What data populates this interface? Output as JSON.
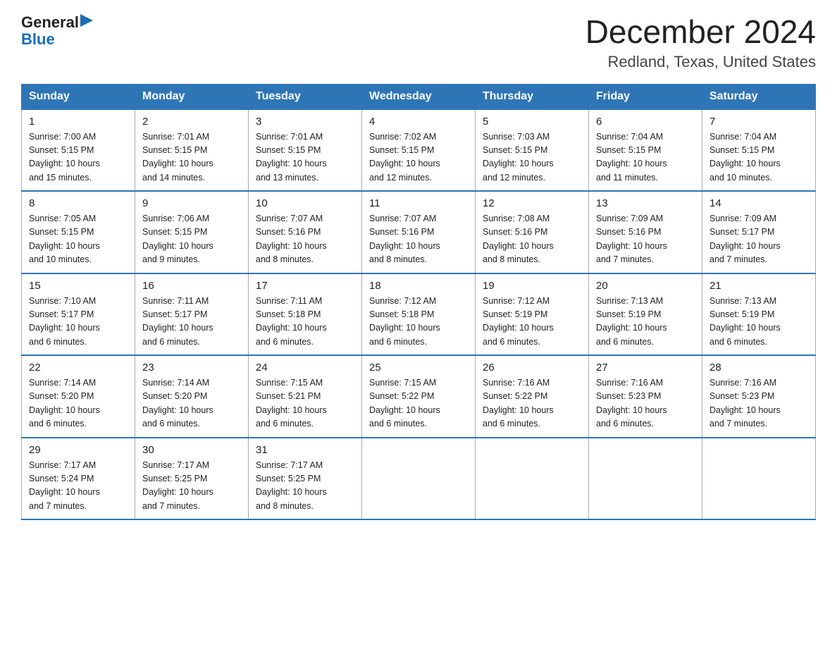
{
  "logo": {
    "general": "General",
    "blue": "Blue",
    "arrow": "▶"
  },
  "title": "December 2024",
  "subtitle": "Redland, Texas, United States",
  "days_of_week": [
    "Sunday",
    "Monday",
    "Tuesday",
    "Wednesday",
    "Thursday",
    "Friday",
    "Saturday"
  ],
  "weeks": [
    [
      {
        "day": "1",
        "sunrise": "7:00 AM",
        "sunset": "5:15 PM",
        "daylight": "10 hours and 15 minutes."
      },
      {
        "day": "2",
        "sunrise": "7:01 AM",
        "sunset": "5:15 PM",
        "daylight": "10 hours and 14 minutes."
      },
      {
        "day": "3",
        "sunrise": "7:01 AM",
        "sunset": "5:15 PM",
        "daylight": "10 hours and 13 minutes."
      },
      {
        "day": "4",
        "sunrise": "7:02 AM",
        "sunset": "5:15 PM",
        "daylight": "10 hours and 12 minutes."
      },
      {
        "day": "5",
        "sunrise": "7:03 AM",
        "sunset": "5:15 PM",
        "daylight": "10 hours and 12 minutes."
      },
      {
        "day": "6",
        "sunrise": "7:04 AM",
        "sunset": "5:15 PM",
        "daylight": "10 hours and 11 minutes."
      },
      {
        "day": "7",
        "sunrise": "7:04 AM",
        "sunset": "5:15 PM",
        "daylight": "10 hours and 10 minutes."
      }
    ],
    [
      {
        "day": "8",
        "sunrise": "7:05 AM",
        "sunset": "5:15 PM",
        "daylight": "10 hours and 10 minutes."
      },
      {
        "day": "9",
        "sunrise": "7:06 AM",
        "sunset": "5:15 PM",
        "daylight": "10 hours and 9 minutes."
      },
      {
        "day": "10",
        "sunrise": "7:07 AM",
        "sunset": "5:16 PM",
        "daylight": "10 hours and 8 minutes."
      },
      {
        "day": "11",
        "sunrise": "7:07 AM",
        "sunset": "5:16 PM",
        "daylight": "10 hours and 8 minutes."
      },
      {
        "day": "12",
        "sunrise": "7:08 AM",
        "sunset": "5:16 PM",
        "daylight": "10 hours and 8 minutes."
      },
      {
        "day": "13",
        "sunrise": "7:09 AM",
        "sunset": "5:16 PM",
        "daylight": "10 hours and 7 minutes."
      },
      {
        "day": "14",
        "sunrise": "7:09 AM",
        "sunset": "5:17 PM",
        "daylight": "10 hours and 7 minutes."
      }
    ],
    [
      {
        "day": "15",
        "sunrise": "7:10 AM",
        "sunset": "5:17 PM",
        "daylight": "10 hours and 6 minutes."
      },
      {
        "day": "16",
        "sunrise": "7:11 AM",
        "sunset": "5:17 PM",
        "daylight": "10 hours and 6 minutes."
      },
      {
        "day": "17",
        "sunrise": "7:11 AM",
        "sunset": "5:18 PM",
        "daylight": "10 hours and 6 minutes."
      },
      {
        "day": "18",
        "sunrise": "7:12 AM",
        "sunset": "5:18 PM",
        "daylight": "10 hours and 6 minutes."
      },
      {
        "day": "19",
        "sunrise": "7:12 AM",
        "sunset": "5:19 PM",
        "daylight": "10 hours and 6 minutes."
      },
      {
        "day": "20",
        "sunrise": "7:13 AM",
        "sunset": "5:19 PM",
        "daylight": "10 hours and 6 minutes."
      },
      {
        "day": "21",
        "sunrise": "7:13 AM",
        "sunset": "5:19 PM",
        "daylight": "10 hours and 6 minutes."
      }
    ],
    [
      {
        "day": "22",
        "sunrise": "7:14 AM",
        "sunset": "5:20 PM",
        "daylight": "10 hours and 6 minutes."
      },
      {
        "day": "23",
        "sunrise": "7:14 AM",
        "sunset": "5:20 PM",
        "daylight": "10 hours and 6 minutes."
      },
      {
        "day": "24",
        "sunrise": "7:15 AM",
        "sunset": "5:21 PM",
        "daylight": "10 hours and 6 minutes."
      },
      {
        "day": "25",
        "sunrise": "7:15 AM",
        "sunset": "5:22 PM",
        "daylight": "10 hours and 6 minutes."
      },
      {
        "day": "26",
        "sunrise": "7:16 AM",
        "sunset": "5:22 PM",
        "daylight": "10 hours and 6 minutes."
      },
      {
        "day": "27",
        "sunrise": "7:16 AM",
        "sunset": "5:23 PM",
        "daylight": "10 hours and 6 minutes."
      },
      {
        "day": "28",
        "sunrise": "7:16 AM",
        "sunset": "5:23 PM",
        "daylight": "10 hours and 7 minutes."
      }
    ],
    [
      {
        "day": "29",
        "sunrise": "7:17 AM",
        "sunset": "5:24 PM",
        "daylight": "10 hours and 7 minutes."
      },
      {
        "day": "30",
        "sunrise": "7:17 AM",
        "sunset": "5:25 PM",
        "daylight": "10 hours and 7 minutes."
      },
      {
        "day": "31",
        "sunrise": "7:17 AM",
        "sunset": "5:25 PM",
        "daylight": "10 hours and 8 minutes."
      },
      null,
      null,
      null,
      null
    ]
  ],
  "labels": {
    "sunrise": "Sunrise:",
    "sunset": "Sunset:",
    "daylight": "Daylight:"
  }
}
